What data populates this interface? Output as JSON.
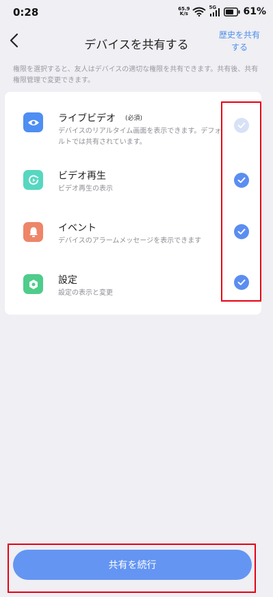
{
  "status_bar": {
    "time": "0:28",
    "net_speed_value": "65.9",
    "net_speed_unit": "K/s",
    "signal_label": "5G",
    "battery": "61%"
  },
  "header": {
    "title": "デバイスを共有する",
    "history_link_line1": "歴史を共有",
    "history_link_line2": "する",
    "back_icon": "chevron-left-icon"
  },
  "description": "権限を選択すると、友人はデバイスの適切な権限を共有できます。共有後、共有権限管理で変更できます。",
  "permissions": [
    {
      "title": "ライブビデオ",
      "tag": "(必須)",
      "desc": "デバイスのリアルタイム画面を表示できます。デフォルトでは共有されています。",
      "icon": "eye-icon",
      "icon_color": "#4f8ef2",
      "checked": true,
      "disabled": true
    },
    {
      "title": "ビデオ再生",
      "desc": "ビデオ再生の表示",
      "icon": "playback-icon",
      "icon_color": "#57d7c0",
      "checked": true
    },
    {
      "title": "イベント",
      "desc": "デバイスのアラームメッセージを表示できます",
      "icon": "bell-icon",
      "icon_color": "#ee8569",
      "checked": true
    },
    {
      "title": "設定",
      "desc": "設定の表示と変更",
      "icon": "settings-icon",
      "icon_color": "#4fcc8b",
      "checked": true
    }
  ],
  "colors": {
    "accent": "#5b8ef0",
    "check_disabled": "#d7e2f7",
    "button": "#6495f2",
    "highlight": "#e60012"
  },
  "continue_button": "共有を続行"
}
